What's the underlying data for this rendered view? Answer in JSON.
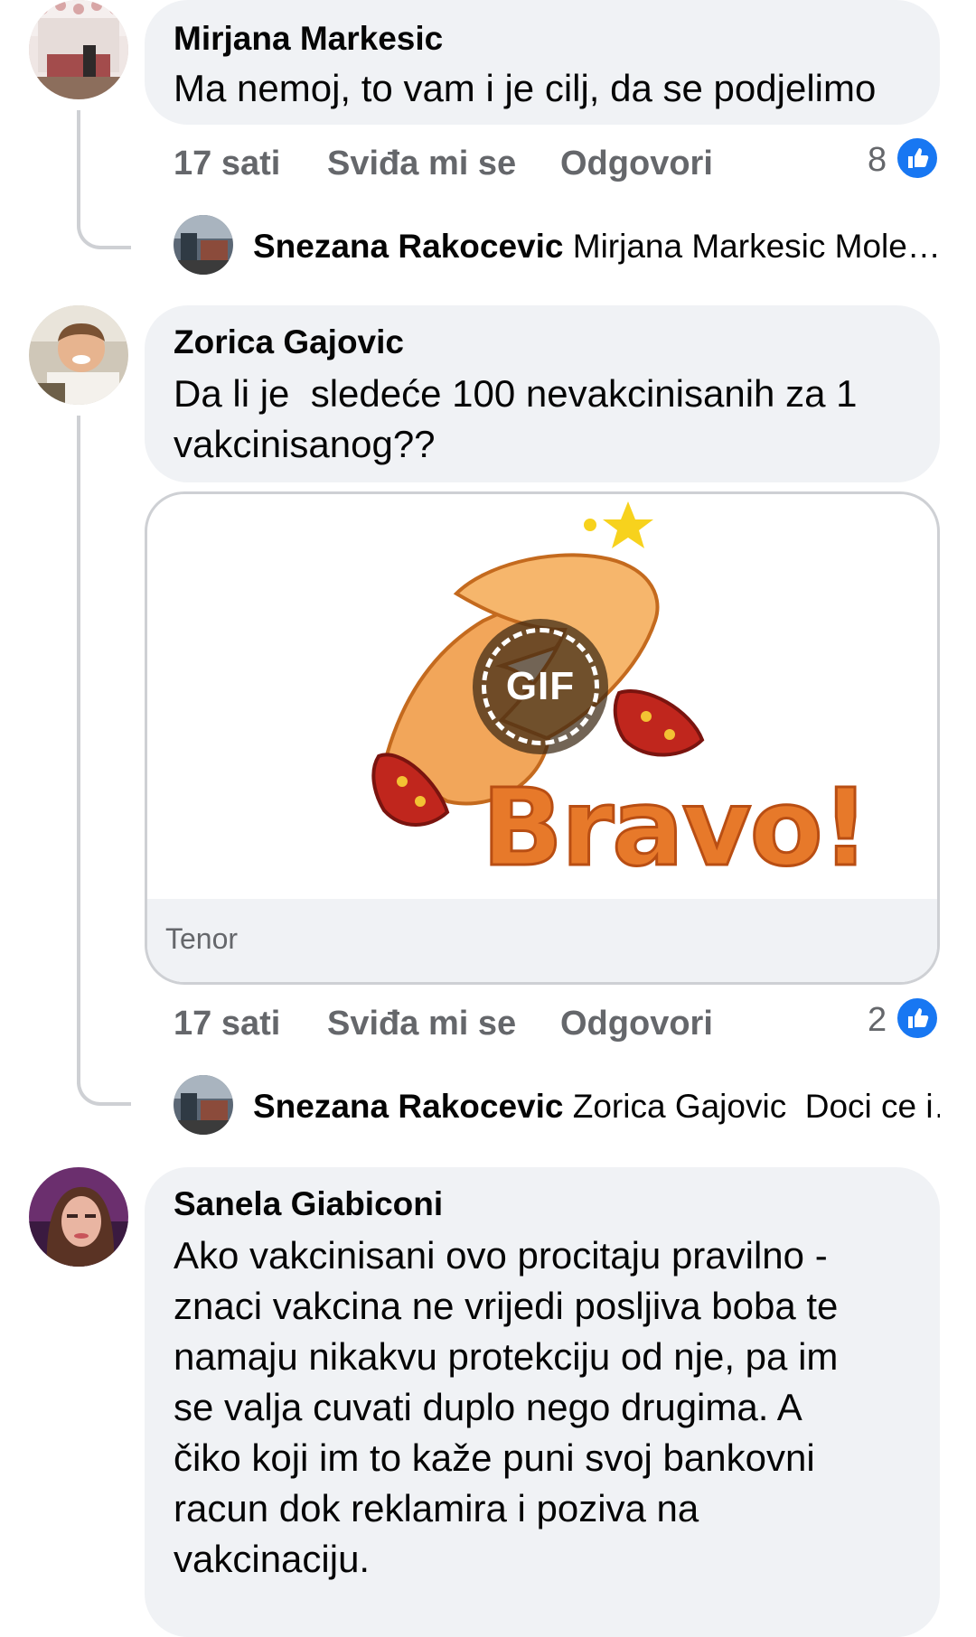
{
  "comments": [
    {
      "author": "Mirjana Markesic",
      "text": "Ma nemoj, to vam i je cilj, da se podjelimo",
      "time": "17 sati",
      "like_label": "Sviđa mi se",
      "reply_label": "Odgovori",
      "like_count": "8",
      "reply": {
        "author": "Snezana Rakocevic",
        "preview": "Mirjana Markesic Mole…"
      }
    },
    {
      "author": "Zorica Gajovic",
      "text_lines": [
        "Da li je  sledeće 100 nevakcinisanih za 1",
        "vakcinisanog??"
      ],
      "gif": {
        "badge": "GIF",
        "caption": "Bravo!",
        "source": "Tenor"
      },
      "time": "17 sati",
      "like_label": "Sviđa mi se",
      "reply_label": "Odgovori",
      "like_count": "2",
      "reply": {
        "author": "Snezana Rakocevic",
        "preview": "Zorica Gajovic  Doci ce i…"
      }
    },
    {
      "author": "Sanela Giabiconi",
      "text_lines": [
        "Ako vakcinisani ovo procitaju pravilno -",
        "znaci vakcina ne vrijedi posljiva boba te",
        "namaju nikakvu protekciju od nje, pa im",
        "se valja cuvati duplo nego drugima. A",
        "čiko koji im to kaže puni svoj bankovni",
        "racun dok reklamira i poziva na",
        "vakcinaciju."
      ]
    }
  ],
  "colors": {
    "bubble": "#f0f2f5",
    "meta": "#65676b",
    "like_blue": "#1877f2",
    "thread": "#ced0d4"
  },
  "icons": {
    "like": "thumbs-up-icon"
  }
}
